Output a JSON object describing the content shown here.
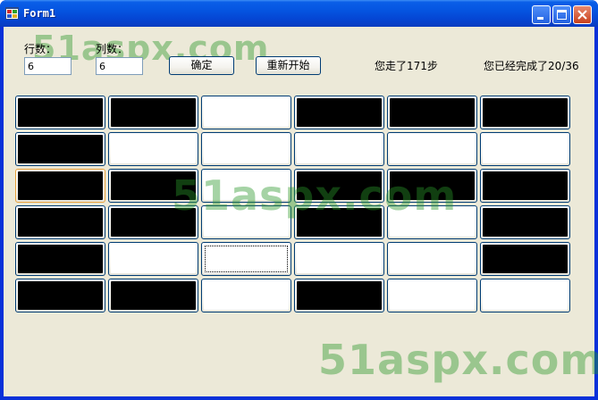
{
  "window": {
    "title": "Form1"
  },
  "controls": {
    "rows_label": "行数：",
    "rows_value": "6",
    "cols_label": "列数：",
    "cols_value": "6",
    "confirm_label": "确定",
    "restart_label": "重新开始",
    "steps_text": "您走了171步",
    "progress_text": "您已经完成了20/36"
  },
  "grid": {
    "rows": 6,
    "cols": 6,
    "cells": [
      [
        "black",
        "black",
        "white",
        "black",
        "black",
        "black"
      ],
      [
        "black",
        "white",
        "white",
        "white",
        "white",
        "white"
      ],
      [
        "black",
        "black",
        "white",
        "black",
        "black",
        "black"
      ],
      [
        "black",
        "black",
        "white",
        "black",
        "white",
        "black"
      ],
      [
        "black",
        "white",
        "white",
        "white",
        "white",
        "black"
      ],
      [
        "black",
        "black",
        "white",
        "black",
        "white",
        "white"
      ]
    ],
    "focused_cell": [
      4,
      2
    ],
    "hover_cell": [
      2,
      0
    ]
  },
  "watermark": {
    "text": "51aspx.com"
  },
  "colors": {
    "titlebar": "#0554e0",
    "client_bg": "#ece9d8",
    "cell_dark": "#000000",
    "cell_light": "#ffffff",
    "watermark": "#2a962a"
  },
  "icons": {
    "app": "windows-form-icon",
    "minimize": "minimize-icon",
    "maximize": "maximize-icon",
    "close": "close-icon"
  }
}
